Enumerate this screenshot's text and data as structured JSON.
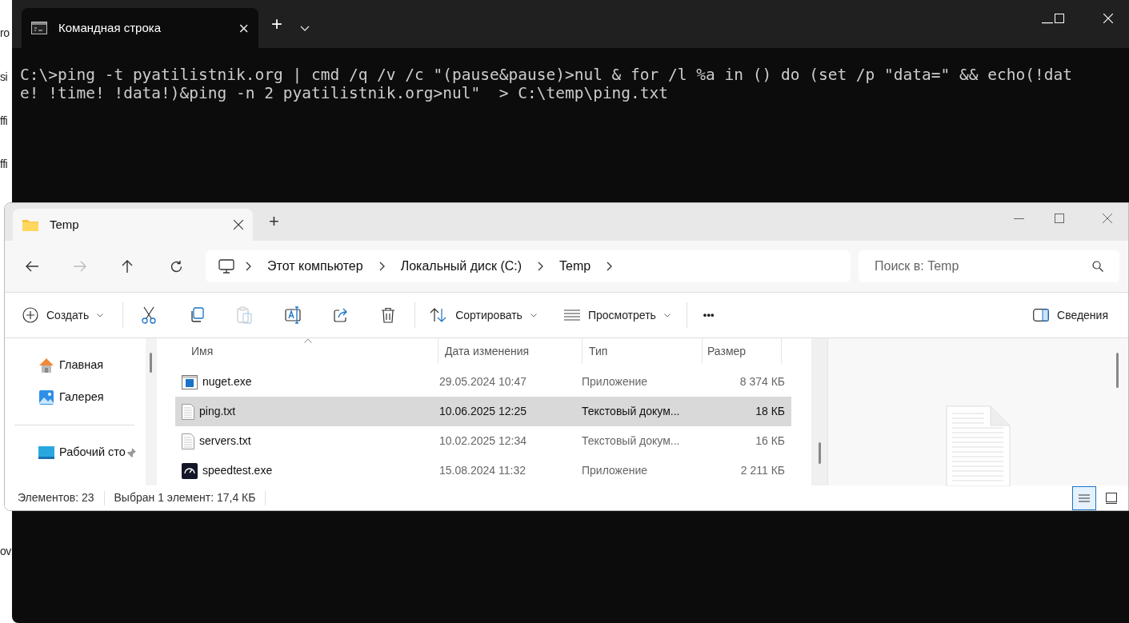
{
  "background_page": {
    "fragments": [
      "ro",
      "si",
      "ffi",
      "ffi",
      "ov"
    ]
  },
  "console": {
    "tab_title": "Командная строка",
    "tab_close": "×",
    "new_tab": "+",
    "lines": [
      "C:\\>ping -t pyatilistnik.org | cmd /q /v /c \"(pause&pause)>nul & for /l %a in () do (set /p \"data=\" && echo(!dat",
      "e! !time! !data!)&ping -n 2 pyatilistnik.org>nul\"  > C:\\temp\\ping.txt"
    ]
  },
  "explorer": {
    "tab_title": "Temp",
    "new_tab": "+",
    "breadcrumb": [
      "Этот компьютер",
      "Локальный диск (C:)",
      "Temp"
    ],
    "search": {
      "placeholder": "Поиск в: Temp"
    },
    "toolbar": {
      "create": "Создать",
      "sort": "Сортировать",
      "view": "Просмотреть",
      "more": "•••",
      "details": "Сведения"
    },
    "sidebar": {
      "items": [
        {
          "label": "Главная",
          "kind": "home",
          "pinned": false
        },
        {
          "label": "Галерея",
          "kind": "gallery",
          "pinned": false
        },
        {
          "label": "Рабочий сто",
          "kind": "desktop",
          "pinned": true
        }
      ]
    },
    "table": {
      "columns": [
        "Имя",
        "Дата изменения",
        "Тип",
        "Размер"
      ],
      "rows": [
        {
          "name": "nuget.exe",
          "date": "29.05.2024 10:47",
          "type": "Приложение",
          "size": "8 374 КБ",
          "kind": "app",
          "selected": false
        },
        {
          "name": "ping.txt",
          "date": "10.06.2025 12:25",
          "type": "Текстовый докум...",
          "size": "18 КБ",
          "kind": "text",
          "selected": true
        },
        {
          "name": "servers.txt",
          "date": "10.02.2025 12:34",
          "type": "Текстовый докум...",
          "size": "16 КБ",
          "kind": "text",
          "selected": false
        },
        {
          "name": "speedtest.exe",
          "date": "15.08.2024 11:32",
          "type": "Приложение",
          "size": "2 211 КБ",
          "kind": "gauge",
          "selected": false
        }
      ]
    },
    "status_bar": {
      "count": "Элементов: 23",
      "selection": "Выбран 1 элемент: 17,4 КБ"
    },
    "view_modes": [
      {
        "kind": "details",
        "selected": true
      },
      {
        "kind": "tiles",
        "selected": false
      }
    ]
  }
}
